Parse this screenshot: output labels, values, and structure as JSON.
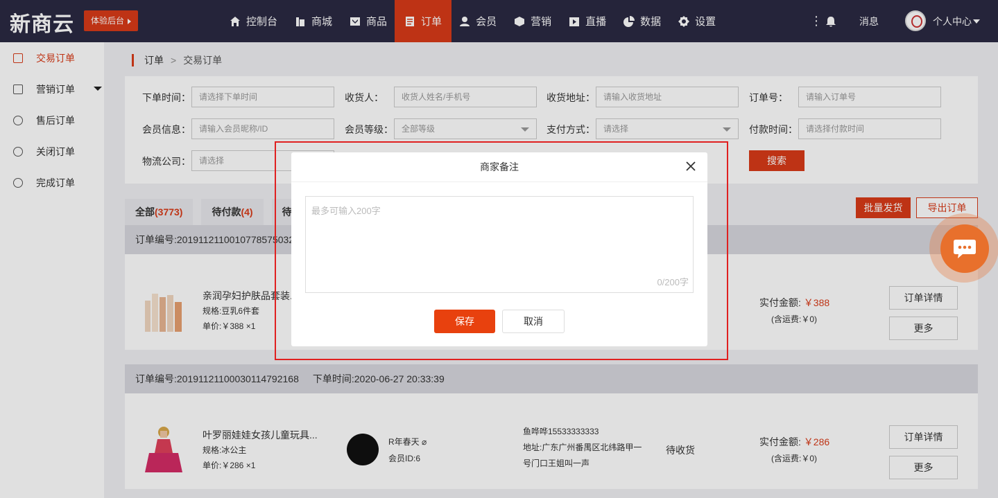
{
  "brand": {
    "logo": "新商云",
    "trial_label": "体验后台",
    "accent": "#d93b18",
    "header_bg": "#2b2942"
  },
  "nav": [
    {
      "label": "控制台",
      "icon": "home-icon"
    },
    {
      "label": "商城",
      "icon": "store-icon"
    },
    {
      "label": "商品",
      "icon": "goods-icon"
    },
    {
      "label": "订单",
      "icon": "order-icon",
      "active": true
    },
    {
      "label": "会员",
      "icon": "user-icon"
    },
    {
      "label": "营销",
      "icon": "cube-icon"
    },
    {
      "label": "直播",
      "icon": "live-icon"
    },
    {
      "label": "数据",
      "icon": "pie-icon"
    },
    {
      "label": "设置",
      "icon": "gear-icon"
    }
  ],
  "header_right": {
    "messages": "消息",
    "user": "个人中心"
  },
  "sidebar": [
    {
      "label": "交易订单",
      "active": true
    },
    {
      "label": "营销订单"
    },
    {
      "label": "售后订单"
    },
    {
      "label": "关闭订单"
    },
    {
      "label": "完成订单"
    }
  ],
  "breadcrumb": {
    "root": "订单",
    "sep": ">",
    "current": "交易订单"
  },
  "filters": {
    "order_time": {
      "label": "下单时间：",
      "placeholder": "请选择下单时间"
    },
    "receiver": {
      "label": "收货人：",
      "placeholder": "收货人姓名/手机号"
    },
    "address": {
      "label": "收货地址：",
      "placeholder": "请输入收货地址"
    },
    "order_no": {
      "label": "订单号：",
      "placeholder": "请输入订单号"
    },
    "member_info": {
      "label": "会员信息：",
      "placeholder": "请输入会员昵称/ID"
    },
    "member_level": {
      "label": "会员等级：",
      "value": "全部等级"
    },
    "pay_method": {
      "label": "支付方式：",
      "value": "请选择"
    },
    "pay_time": {
      "label": "付款时间：",
      "placeholder": "请选择付款时间"
    },
    "logistics": {
      "label": "物流公司：",
      "value": "请选择"
    },
    "search": "搜索"
  },
  "tabs": [
    {
      "label": "全部",
      "count": "(3773)"
    },
    {
      "label": "待付款",
      "count": "(4)"
    },
    {
      "label": "待",
      "count": ""
    }
  ],
  "actions": {
    "batch_ship": "批量发货",
    "export": "导出订单"
  },
  "orders": [
    {
      "head_no": "订单编号:201911211001077857503211",
      "head_time": "",
      "name": "亲润孕妇护肤品套装...",
      "spec": "规格:豆乳6件套",
      "price": "单价:￥388  ×1",
      "paid_label": "实付金额:",
      "paid_amt": "￥388",
      "shipping": "(含运费:￥0)",
      "btn_detail": "订单详情",
      "btn_more": "更多"
    },
    {
      "head_no": "订单编号:201911211000301147921​68",
      "head_time": "下单时间:2020-06-27 20:33:39",
      "name": "叶罗丽娃娃女孩儿童玩具...",
      "spec": "规格:冰公主",
      "price": "单价:￥286  ×1",
      "buyer_name": "R年春天 ⌀",
      "buyer_id": "会员ID:6",
      "addr1": "鱼哗哗15533333333",
      "addr2": "地址:广东广州番禺区北纬路甲一号门口王姐叫一声",
      "status": "待收货",
      "paid_label": "实付金额:",
      "paid_amt": "￥286",
      "shipping": "(含运费:￥0)",
      "btn_detail": "订单详情",
      "btn_more": "更多"
    }
  ],
  "modal": {
    "title": "商家备注",
    "placeholder": "最多可输入200字",
    "counter": "0/200字",
    "save": "保存",
    "cancel": "取消"
  }
}
